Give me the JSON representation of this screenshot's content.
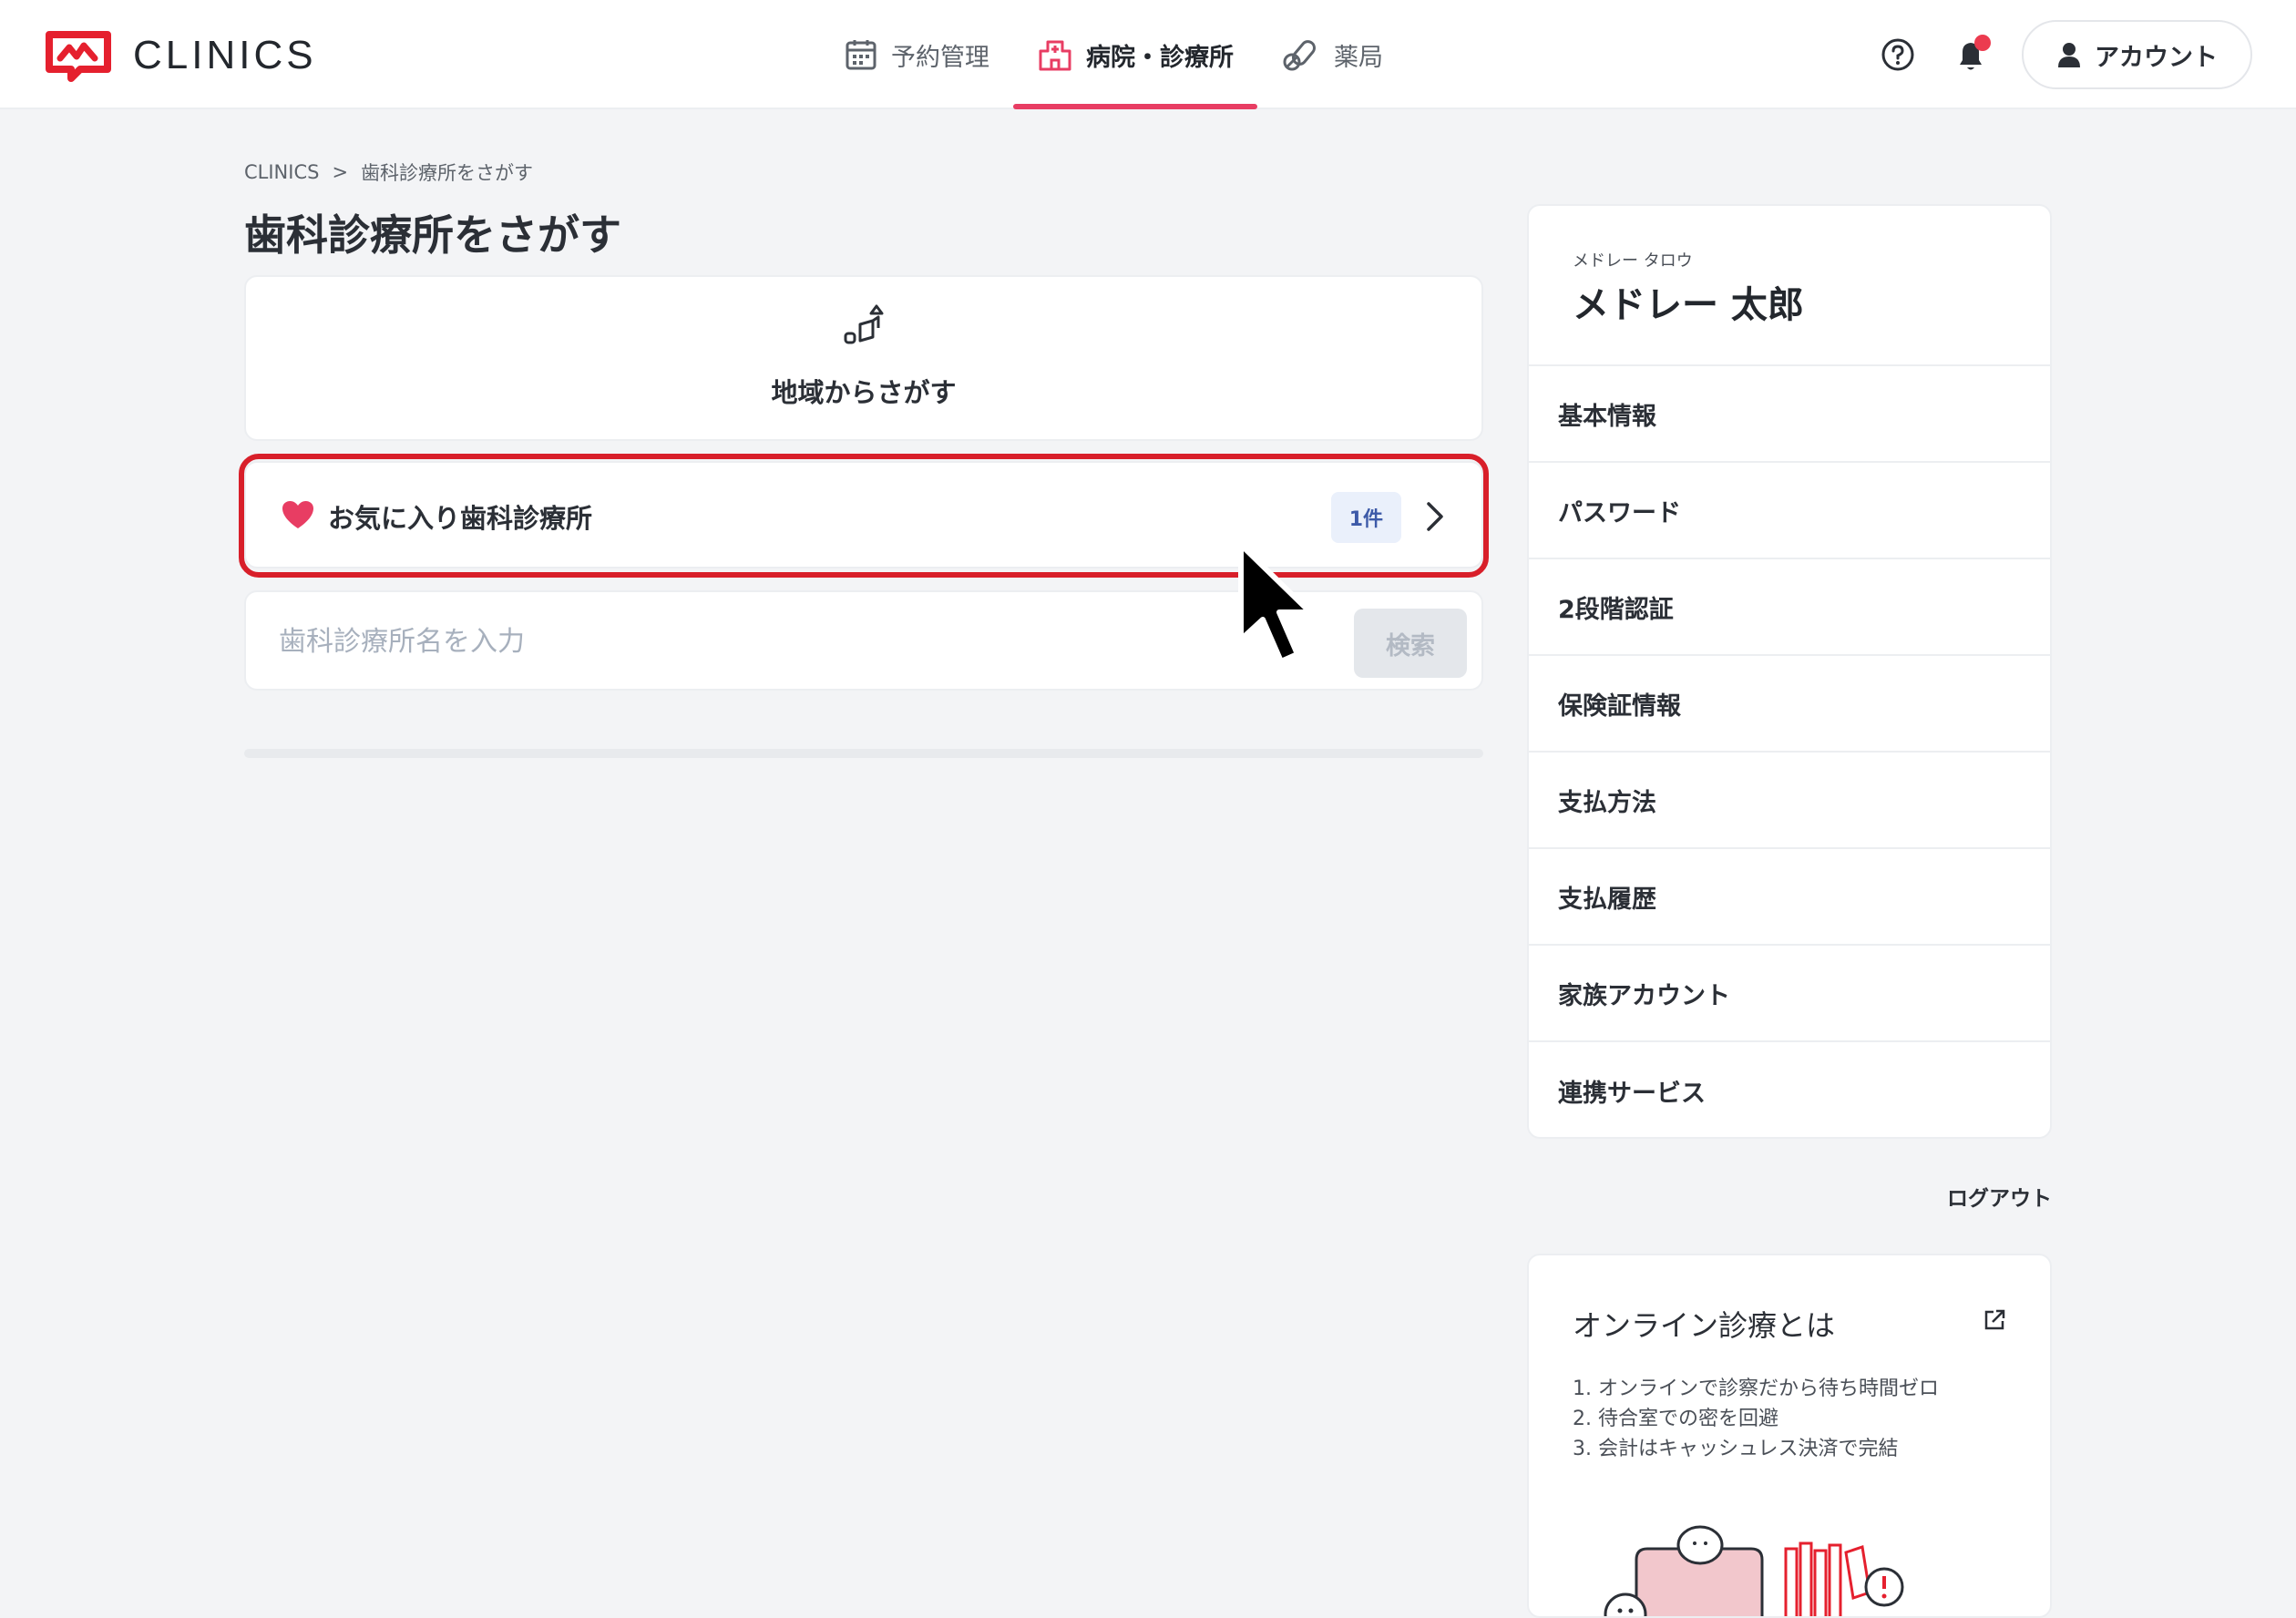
{
  "header": {
    "logo_text": "CLINICS",
    "nav": [
      {
        "label": "予約管理",
        "icon": "calendar-icon",
        "active": false
      },
      {
        "label": "病院・診療所",
        "icon": "hospital-icon",
        "active": true
      },
      {
        "label": "薬局",
        "icon": "pill-icon",
        "active": false
      }
    ],
    "account_label": "アカウント",
    "accent_color": "#e83d63",
    "notification_dot_color": "#ec3b4f"
  },
  "breadcrumb": {
    "items": [
      "CLINICS",
      "歯科診療所をさがす"
    ],
    "separator": ">"
  },
  "page": {
    "title": "歯科診療所をさがす"
  },
  "area_search": {
    "label": "地域からさがす"
  },
  "favorites": {
    "label": "お気に入り歯科診療所",
    "count": "1件",
    "highlight_color": "#d81f2a"
  },
  "search": {
    "placeholder": "歯科診療所名を入力",
    "button_label": "検索",
    "value": ""
  },
  "profile": {
    "kana": "メドレー タロウ",
    "name": "メドレー 太郎",
    "menu": [
      "基本情報",
      "パスワード",
      "2段階認証",
      "保険証情報",
      "支払方法",
      "支払履歴",
      "家族アカウント",
      "連携サービス"
    ]
  },
  "logout_label": "ログアウト",
  "info": {
    "title": "オンライン診療とは",
    "items": [
      "1. オンラインで診察だから待ち時間ゼロ",
      "2. 待合室での密を回避",
      "3. 会計はキャッシュレス決済で完結"
    ]
  }
}
